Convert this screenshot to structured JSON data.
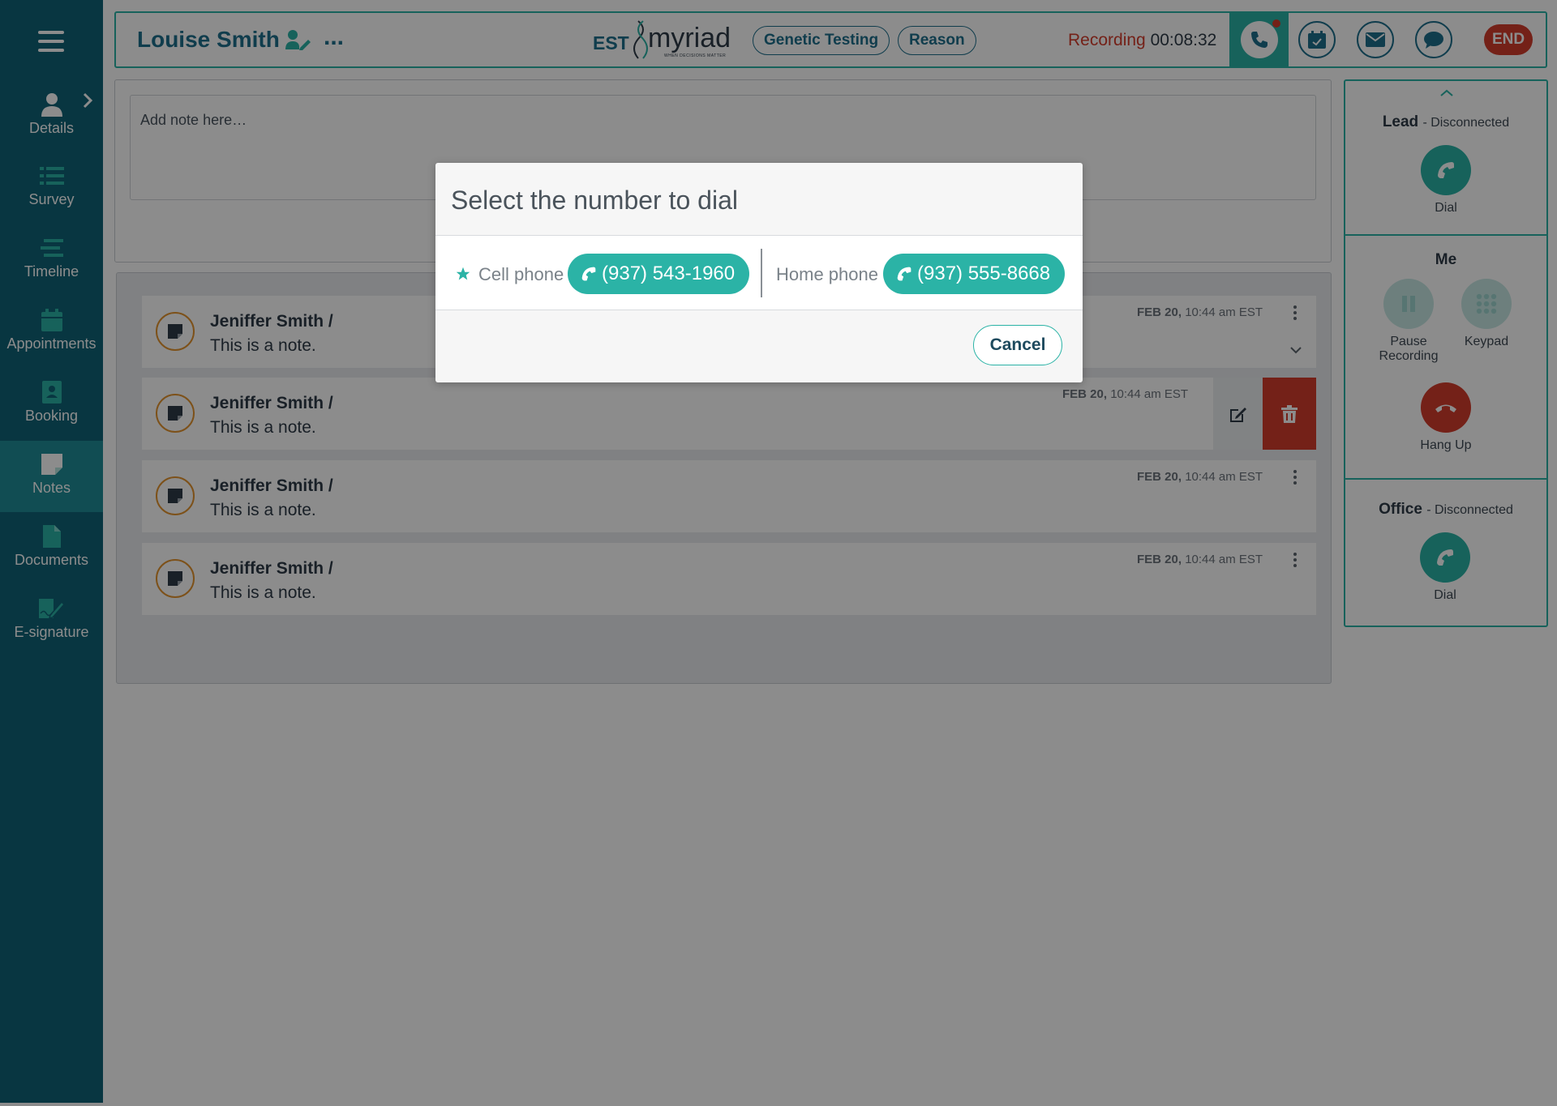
{
  "sidebar": {
    "items": [
      {
        "label": "Details",
        "icon": "person-icon"
      },
      {
        "label": "Survey",
        "icon": "list-icon"
      },
      {
        "label": "Timeline",
        "icon": "timeline-icon"
      },
      {
        "label": "Appointments",
        "icon": "calendar-icon"
      },
      {
        "label": "Booking",
        "icon": "address-book-icon"
      },
      {
        "label": "Notes",
        "icon": "sticky-note-icon",
        "active": true
      },
      {
        "label": "Documents",
        "icon": "document-icon"
      },
      {
        "label": "E-signature",
        "icon": "signature-icon"
      }
    ]
  },
  "header": {
    "patient_name": "Louise Smith",
    "more": "...",
    "timezone": "EST",
    "logo_text": "myriad",
    "logo_tagline": "WHEN DECISIONS MATTER",
    "pill_genetic": "Genetic Testing",
    "pill_reason": "Reason",
    "recording_label": "Recording",
    "recording_time": "00:08:32",
    "end_label": "END"
  },
  "note_input": {
    "placeholder": "Add note here…"
  },
  "notes": [
    {
      "author": "Jeniffer Smith /",
      "text": "This is a note.",
      "date": "FEB 20,",
      "time": "10:44 am EST"
    },
    {
      "author": "Jeniffer Smith /",
      "text": "This is a note.",
      "date": "FEB 20,",
      "time": "10:44 am EST"
    },
    {
      "author": "Jeniffer Smith /",
      "text": "This is a note.",
      "date": "FEB 20,",
      "time": "10:44 am EST"
    },
    {
      "author": "Jeniffer Smith /",
      "text": "This is a note.",
      "date": "FEB 20,",
      "time": "10:44 am EST"
    }
  ],
  "call_panel": {
    "lead_title": "Lead",
    "lead_status": "- Disconnected",
    "lead_dial": "Dial",
    "me_title": "Me",
    "pause_label": "Pause Recording",
    "keypad_label": "Keypad",
    "hangup_label": "Hang Up",
    "office_title": "Office",
    "office_status": "- Disconnected",
    "office_dial": "Dial"
  },
  "modal": {
    "title": "Select the number to dial",
    "cell_label": "Cell phone",
    "cell_number": "(937) 543-1960",
    "home_label": "Home phone",
    "home_number": "(937) 555-8668",
    "cancel_label": "Cancel"
  },
  "colors": {
    "sidebar": "#106377",
    "teal": "#2bb3a6",
    "navy": "#1e6f8c",
    "red": "#d43c2c",
    "orange": "#e3942f"
  }
}
